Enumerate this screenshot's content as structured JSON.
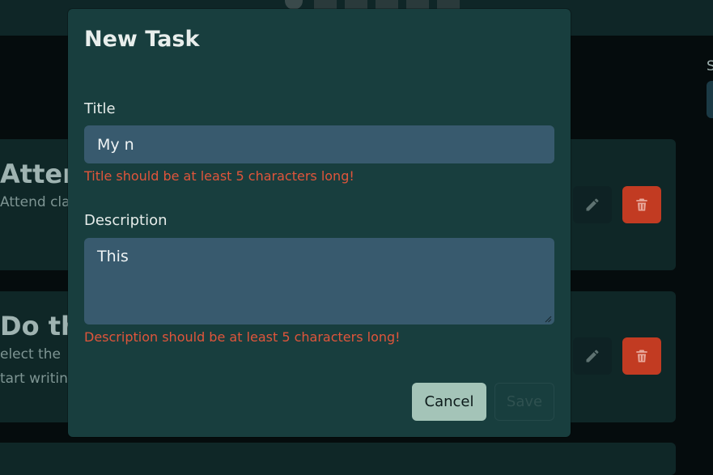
{
  "modal": {
    "title": "New Task",
    "title_field": {
      "label": "Title",
      "value": "My n",
      "error": "Title should be at least 5 characters long!"
    },
    "description_field": {
      "label": "Description",
      "value": "This",
      "error": "Description should be at least 5 characters long!"
    },
    "cancel_label": "Cancel",
    "save_label": "Save",
    "save_disabled": true
  },
  "background": {
    "side_label": "S",
    "cards": [
      {
        "title": "Attend",
        "lines": [
          "Attend clas"
        ]
      },
      {
        "title": "Do the",
        "lines": [
          "elect the",
          "tart writin"
        ]
      }
    ],
    "icons": {
      "edit": "pencil-icon",
      "delete": "trash-icon"
    }
  },
  "colors": {
    "modal_bg": "#183e3e",
    "input_bg": "#385a6e",
    "error": "#e0553b",
    "cancel_bg": "#a4c4b8",
    "delete_bg": "#c23b22"
  }
}
